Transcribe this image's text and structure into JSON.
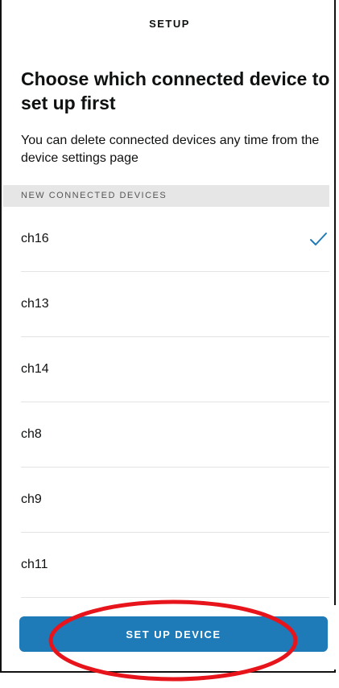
{
  "header": {
    "title": "SETUP"
  },
  "main": {
    "title": "Choose which connected device to set up first",
    "subtitle": "You can delete connected devices any time from the device settings page",
    "section_header": "NEW CONNECTED DEVICES",
    "devices": [
      {
        "label": "ch16",
        "selected": true
      },
      {
        "label": "ch13",
        "selected": false
      },
      {
        "label": "ch14",
        "selected": false
      },
      {
        "label": "ch8",
        "selected": false
      },
      {
        "label": "ch9",
        "selected": false
      },
      {
        "label": "ch11",
        "selected": false
      }
    ],
    "selected_icon": "checkmark-icon"
  },
  "footer": {
    "button_label": "SET UP DEVICE"
  },
  "colors": {
    "accent": "#1f7ab8",
    "annotation": "#e8141c",
    "section_bg": "#e6e6e6"
  }
}
